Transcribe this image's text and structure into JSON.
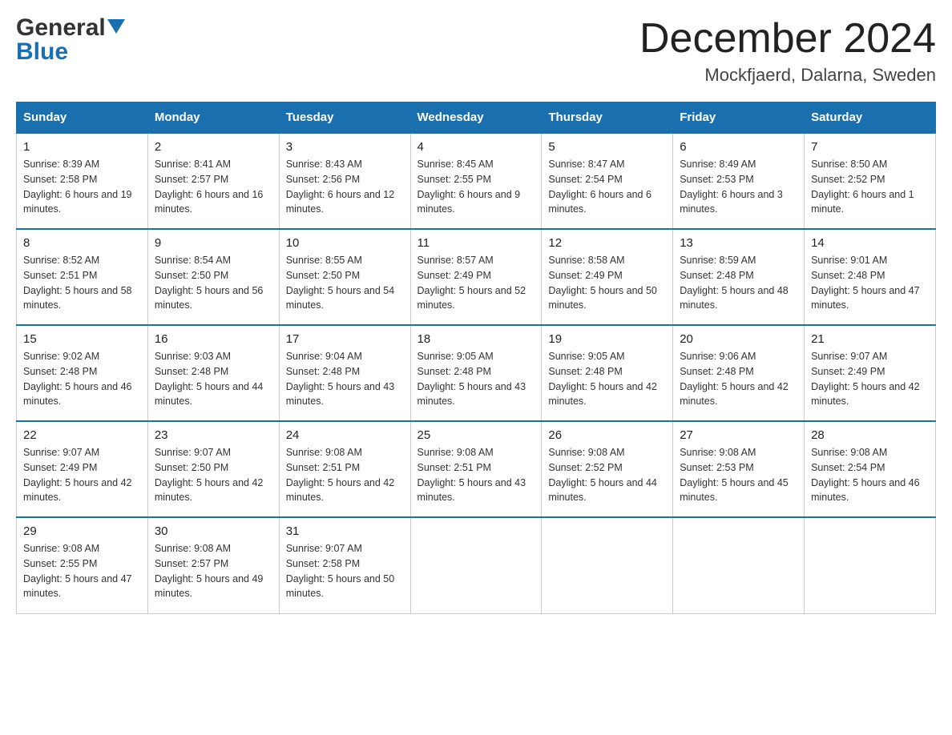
{
  "header": {
    "logo_general": "General",
    "logo_blue": "Blue",
    "month_title": "December 2024",
    "location": "Mockfjaerd, Dalarna, Sweden"
  },
  "days_of_week": [
    "Sunday",
    "Monday",
    "Tuesday",
    "Wednesday",
    "Thursday",
    "Friday",
    "Saturday"
  ],
  "weeks": [
    [
      {
        "day": "1",
        "sunrise": "Sunrise: 8:39 AM",
        "sunset": "Sunset: 2:58 PM",
        "daylight": "Daylight: 6 hours and 19 minutes."
      },
      {
        "day": "2",
        "sunrise": "Sunrise: 8:41 AM",
        "sunset": "Sunset: 2:57 PM",
        "daylight": "Daylight: 6 hours and 16 minutes."
      },
      {
        "day": "3",
        "sunrise": "Sunrise: 8:43 AM",
        "sunset": "Sunset: 2:56 PM",
        "daylight": "Daylight: 6 hours and 12 minutes."
      },
      {
        "day": "4",
        "sunrise": "Sunrise: 8:45 AM",
        "sunset": "Sunset: 2:55 PM",
        "daylight": "Daylight: 6 hours and 9 minutes."
      },
      {
        "day": "5",
        "sunrise": "Sunrise: 8:47 AM",
        "sunset": "Sunset: 2:54 PM",
        "daylight": "Daylight: 6 hours and 6 minutes."
      },
      {
        "day": "6",
        "sunrise": "Sunrise: 8:49 AM",
        "sunset": "Sunset: 2:53 PM",
        "daylight": "Daylight: 6 hours and 3 minutes."
      },
      {
        "day": "7",
        "sunrise": "Sunrise: 8:50 AM",
        "sunset": "Sunset: 2:52 PM",
        "daylight": "Daylight: 6 hours and 1 minute."
      }
    ],
    [
      {
        "day": "8",
        "sunrise": "Sunrise: 8:52 AM",
        "sunset": "Sunset: 2:51 PM",
        "daylight": "Daylight: 5 hours and 58 minutes."
      },
      {
        "day": "9",
        "sunrise": "Sunrise: 8:54 AM",
        "sunset": "Sunset: 2:50 PM",
        "daylight": "Daylight: 5 hours and 56 minutes."
      },
      {
        "day": "10",
        "sunrise": "Sunrise: 8:55 AM",
        "sunset": "Sunset: 2:50 PM",
        "daylight": "Daylight: 5 hours and 54 minutes."
      },
      {
        "day": "11",
        "sunrise": "Sunrise: 8:57 AM",
        "sunset": "Sunset: 2:49 PM",
        "daylight": "Daylight: 5 hours and 52 minutes."
      },
      {
        "day": "12",
        "sunrise": "Sunrise: 8:58 AM",
        "sunset": "Sunset: 2:49 PM",
        "daylight": "Daylight: 5 hours and 50 minutes."
      },
      {
        "day": "13",
        "sunrise": "Sunrise: 8:59 AM",
        "sunset": "Sunset: 2:48 PM",
        "daylight": "Daylight: 5 hours and 48 minutes."
      },
      {
        "day": "14",
        "sunrise": "Sunrise: 9:01 AM",
        "sunset": "Sunset: 2:48 PM",
        "daylight": "Daylight: 5 hours and 47 minutes."
      }
    ],
    [
      {
        "day": "15",
        "sunrise": "Sunrise: 9:02 AM",
        "sunset": "Sunset: 2:48 PM",
        "daylight": "Daylight: 5 hours and 46 minutes."
      },
      {
        "day": "16",
        "sunrise": "Sunrise: 9:03 AM",
        "sunset": "Sunset: 2:48 PM",
        "daylight": "Daylight: 5 hours and 44 minutes."
      },
      {
        "day": "17",
        "sunrise": "Sunrise: 9:04 AM",
        "sunset": "Sunset: 2:48 PM",
        "daylight": "Daylight: 5 hours and 43 minutes."
      },
      {
        "day": "18",
        "sunrise": "Sunrise: 9:05 AM",
        "sunset": "Sunset: 2:48 PM",
        "daylight": "Daylight: 5 hours and 43 minutes."
      },
      {
        "day": "19",
        "sunrise": "Sunrise: 9:05 AM",
        "sunset": "Sunset: 2:48 PM",
        "daylight": "Daylight: 5 hours and 42 minutes."
      },
      {
        "day": "20",
        "sunrise": "Sunrise: 9:06 AM",
        "sunset": "Sunset: 2:48 PM",
        "daylight": "Daylight: 5 hours and 42 minutes."
      },
      {
        "day": "21",
        "sunrise": "Sunrise: 9:07 AM",
        "sunset": "Sunset: 2:49 PM",
        "daylight": "Daylight: 5 hours and 42 minutes."
      }
    ],
    [
      {
        "day": "22",
        "sunrise": "Sunrise: 9:07 AM",
        "sunset": "Sunset: 2:49 PM",
        "daylight": "Daylight: 5 hours and 42 minutes."
      },
      {
        "day": "23",
        "sunrise": "Sunrise: 9:07 AM",
        "sunset": "Sunset: 2:50 PM",
        "daylight": "Daylight: 5 hours and 42 minutes."
      },
      {
        "day": "24",
        "sunrise": "Sunrise: 9:08 AM",
        "sunset": "Sunset: 2:51 PM",
        "daylight": "Daylight: 5 hours and 42 minutes."
      },
      {
        "day": "25",
        "sunrise": "Sunrise: 9:08 AM",
        "sunset": "Sunset: 2:51 PM",
        "daylight": "Daylight: 5 hours and 43 minutes."
      },
      {
        "day": "26",
        "sunrise": "Sunrise: 9:08 AM",
        "sunset": "Sunset: 2:52 PM",
        "daylight": "Daylight: 5 hours and 44 minutes."
      },
      {
        "day": "27",
        "sunrise": "Sunrise: 9:08 AM",
        "sunset": "Sunset: 2:53 PM",
        "daylight": "Daylight: 5 hours and 45 minutes."
      },
      {
        "day": "28",
        "sunrise": "Sunrise: 9:08 AM",
        "sunset": "Sunset: 2:54 PM",
        "daylight": "Daylight: 5 hours and 46 minutes."
      }
    ],
    [
      {
        "day": "29",
        "sunrise": "Sunrise: 9:08 AM",
        "sunset": "Sunset: 2:55 PM",
        "daylight": "Daylight: 5 hours and 47 minutes."
      },
      {
        "day": "30",
        "sunrise": "Sunrise: 9:08 AM",
        "sunset": "Sunset: 2:57 PM",
        "daylight": "Daylight: 5 hours and 49 minutes."
      },
      {
        "day": "31",
        "sunrise": "Sunrise: 9:07 AM",
        "sunset": "Sunset: 2:58 PM",
        "daylight": "Daylight: 5 hours and 50 minutes."
      },
      null,
      null,
      null,
      null
    ]
  ]
}
